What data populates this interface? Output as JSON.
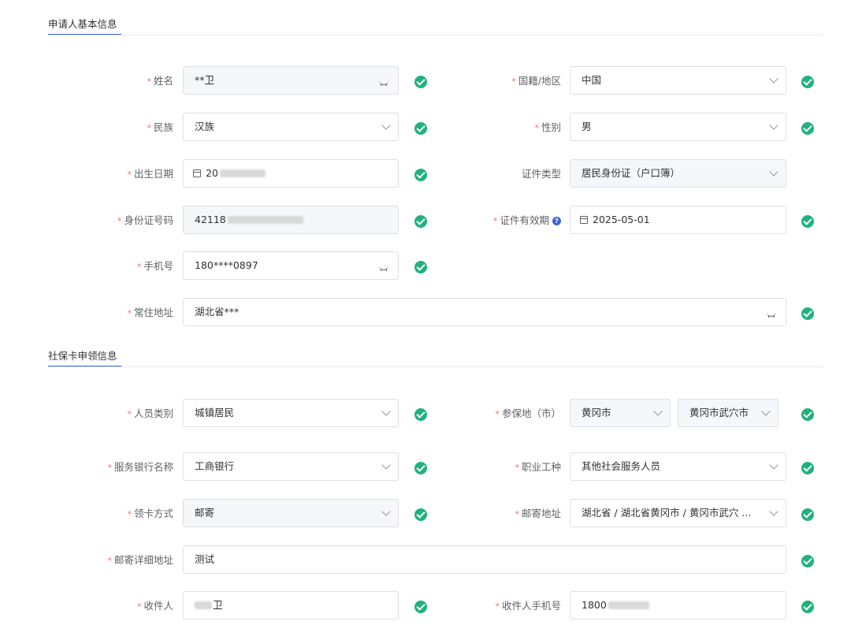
{
  "section1": {
    "title": "申请人基本信息"
  },
  "section2": {
    "title": "社保卡申领信息"
  },
  "fields": {
    "name": {
      "label": "姓名",
      "value": "**卫"
    },
    "nationality": {
      "label": "国籍/地区",
      "value": "中国"
    },
    "ethnicity": {
      "label": "民族",
      "value": "汉族"
    },
    "gender": {
      "label": "性别",
      "value": "男"
    },
    "birthdate": {
      "label": "出生日期",
      "value": "20"
    },
    "id_type": {
      "label": "证件类型",
      "value": "居民身份证（户口簿）"
    },
    "id_number": {
      "label": "身份证号码",
      "value": "42118"
    },
    "id_validity": {
      "label": "证件有效期",
      "value": "2025-05-01"
    },
    "phone": {
      "label": "手机号",
      "value": "180****0897"
    },
    "address": {
      "label": "常住地址",
      "value": "湖北省***"
    },
    "person_type": {
      "label": "人员类别",
      "value": "城镇居民"
    },
    "insured_place": {
      "label": "参保地（市）",
      "city": "黄冈市",
      "district": "黄冈市武穴市"
    },
    "bank": {
      "label": "服务银行名称",
      "value": "工商银行"
    },
    "occupation": {
      "label": "职业工种",
      "value": "其他社会服务人员"
    },
    "pickup": {
      "label": "领卡方式",
      "value": "邮寄"
    },
    "mail_address": {
      "label": "邮寄地址",
      "value": "湖北省 / 湖北省黄冈市 / 黄冈市武穴 ..."
    },
    "mail_detail": {
      "label": "邮寄详细地址",
      "value": "测试"
    },
    "recipient": {
      "label": "收件人",
      "value": "卫"
    },
    "recipient_phone": {
      "label": "收件人手机号",
      "value": "1800"
    }
  },
  "colors": {
    "accent": "#3a63d9",
    "success": "#20b27c",
    "required": "#f56c6c"
  }
}
